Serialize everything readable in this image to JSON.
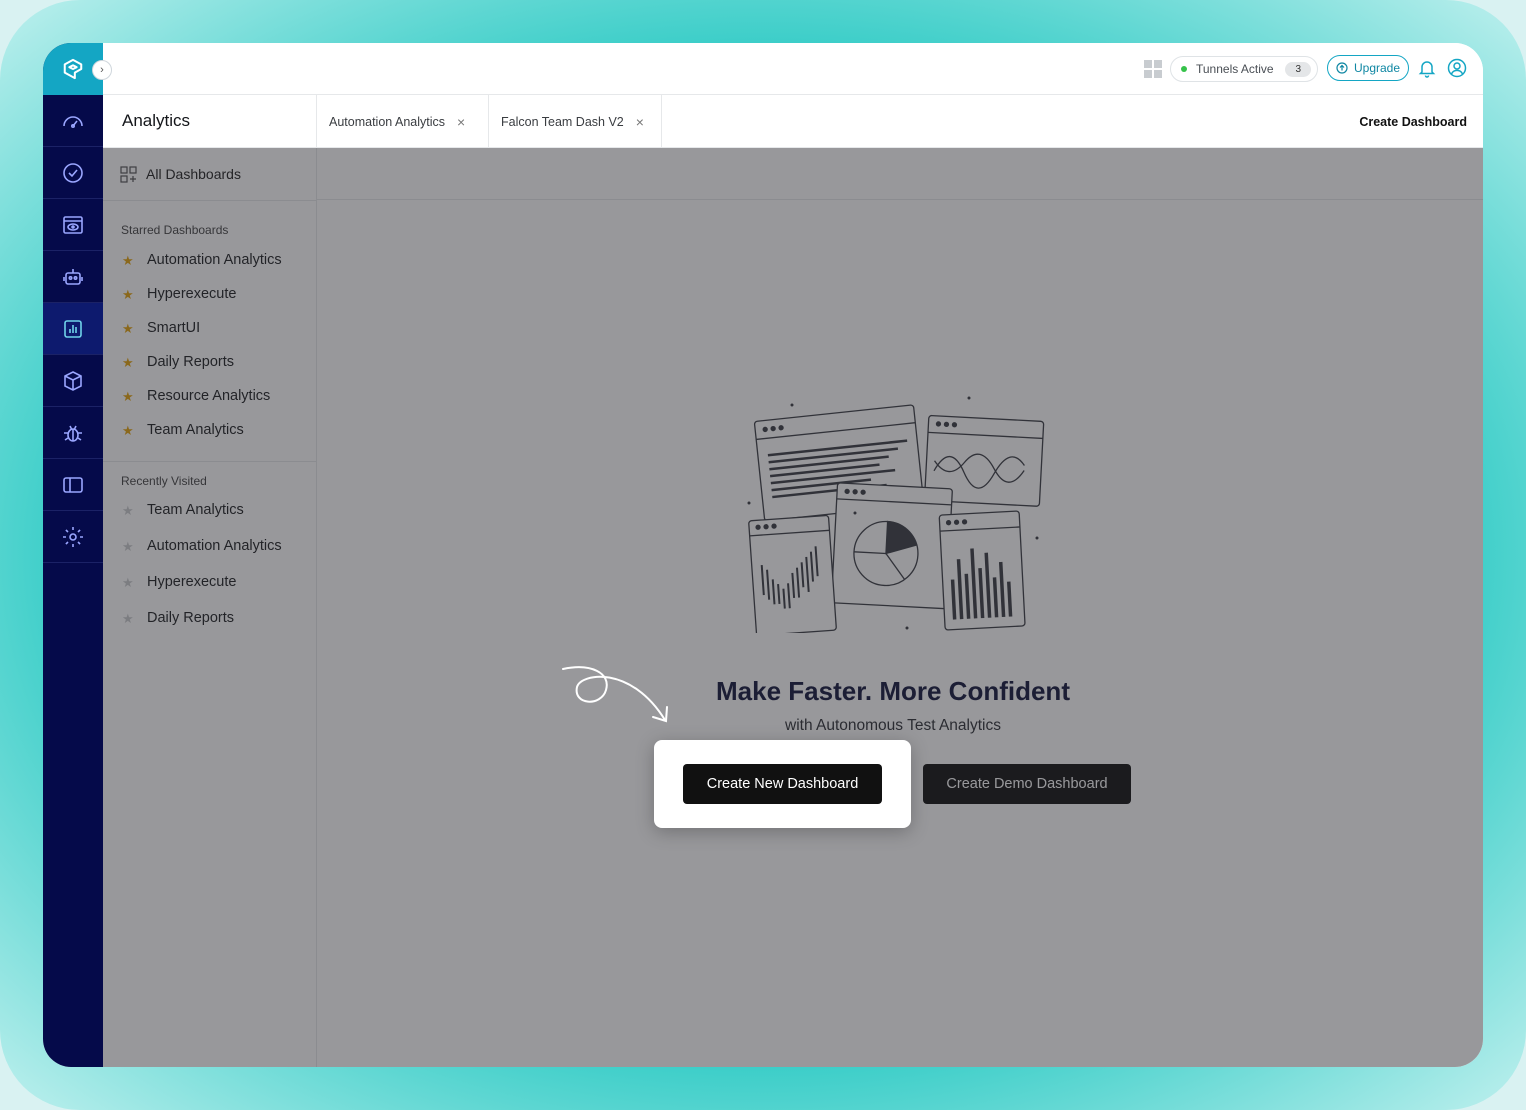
{
  "topbar": {
    "tunnels_label": "Tunnels Active",
    "tunnels_count": "3",
    "upgrade_label": "Upgrade"
  },
  "sidebar": {
    "title": "Analytics",
    "all_dashboards": "All Dashboards",
    "starred_label": "Starred Dashboards",
    "starred": [
      "Automation Analytics",
      "Hyperexecute",
      "SmartUI",
      "Daily Reports",
      "Resource Analytics",
      "Team Analytics"
    ],
    "recent_label": "Recently Visited",
    "recent": [
      "Team Analytics",
      "Automation Analytics",
      "Hyperexecute",
      "Daily Reports"
    ]
  },
  "tabs": [
    {
      "label": "Automation Analytics"
    },
    {
      "label": "Falcon Team Dash V2"
    }
  ],
  "tab_close_glyph": "×",
  "create_dashboard_link": "Create Dashboard",
  "main": {
    "headline": "Make Faster. More Confident",
    "subhead": "with Autonomous Test Analytics",
    "create_new_button": "Create New Dashboard",
    "create_demo_button": "Create Demo Dashboard"
  },
  "icons": {
    "rail": [
      "dashboard-gauge-icon",
      "clock-check-icon",
      "browser-eye-icon",
      "robot-icon",
      "analytics-chart-icon",
      "cube-icon",
      "bug-icon",
      "split-screen-icon",
      "gear-icon"
    ]
  },
  "colors": {
    "rail_bg": "#050a4a",
    "brand": "#14a6c4",
    "star": "#e5a30c"
  }
}
